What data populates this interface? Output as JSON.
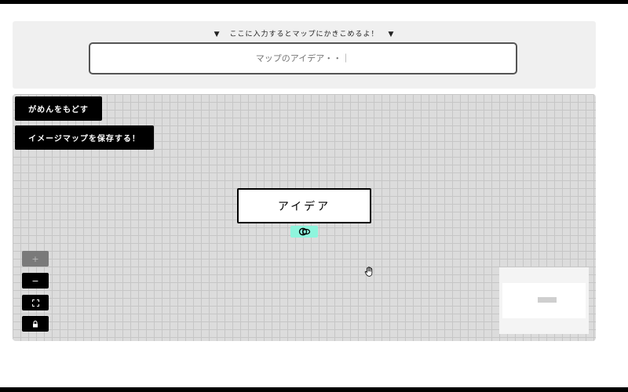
{
  "input_panel": {
    "prompt": "ここに入力するとマップにかきこめるよ！",
    "prompt_marker": "▼",
    "placeholder": "マップのアイデア・・｜"
  },
  "toolbar": {
    "reset_label": "がめんをもどす",
    "save_label": "イメージマップを保存する！"
  },
  "map": {
    "root_node_label": "アイデア",
    "handle_color": "#8ef5dd"
  },
  "controls": {
    "zoom_in_label": "+",
    "zoom_out_label": "−",
    "zoom_in_icon": "plus-icon",
    "zoom_out_icon": "minus-icon",
    "fit_icon": "fit-view-icon",
    "lock_icon": "lock-icon",
    "zoom_in_disabled": true
  },
  "colors": {
    "canvas_background": "#dcdcdc",
    "button_background": "#000000",
    "accent": "#8ef5dd"
  }
}
